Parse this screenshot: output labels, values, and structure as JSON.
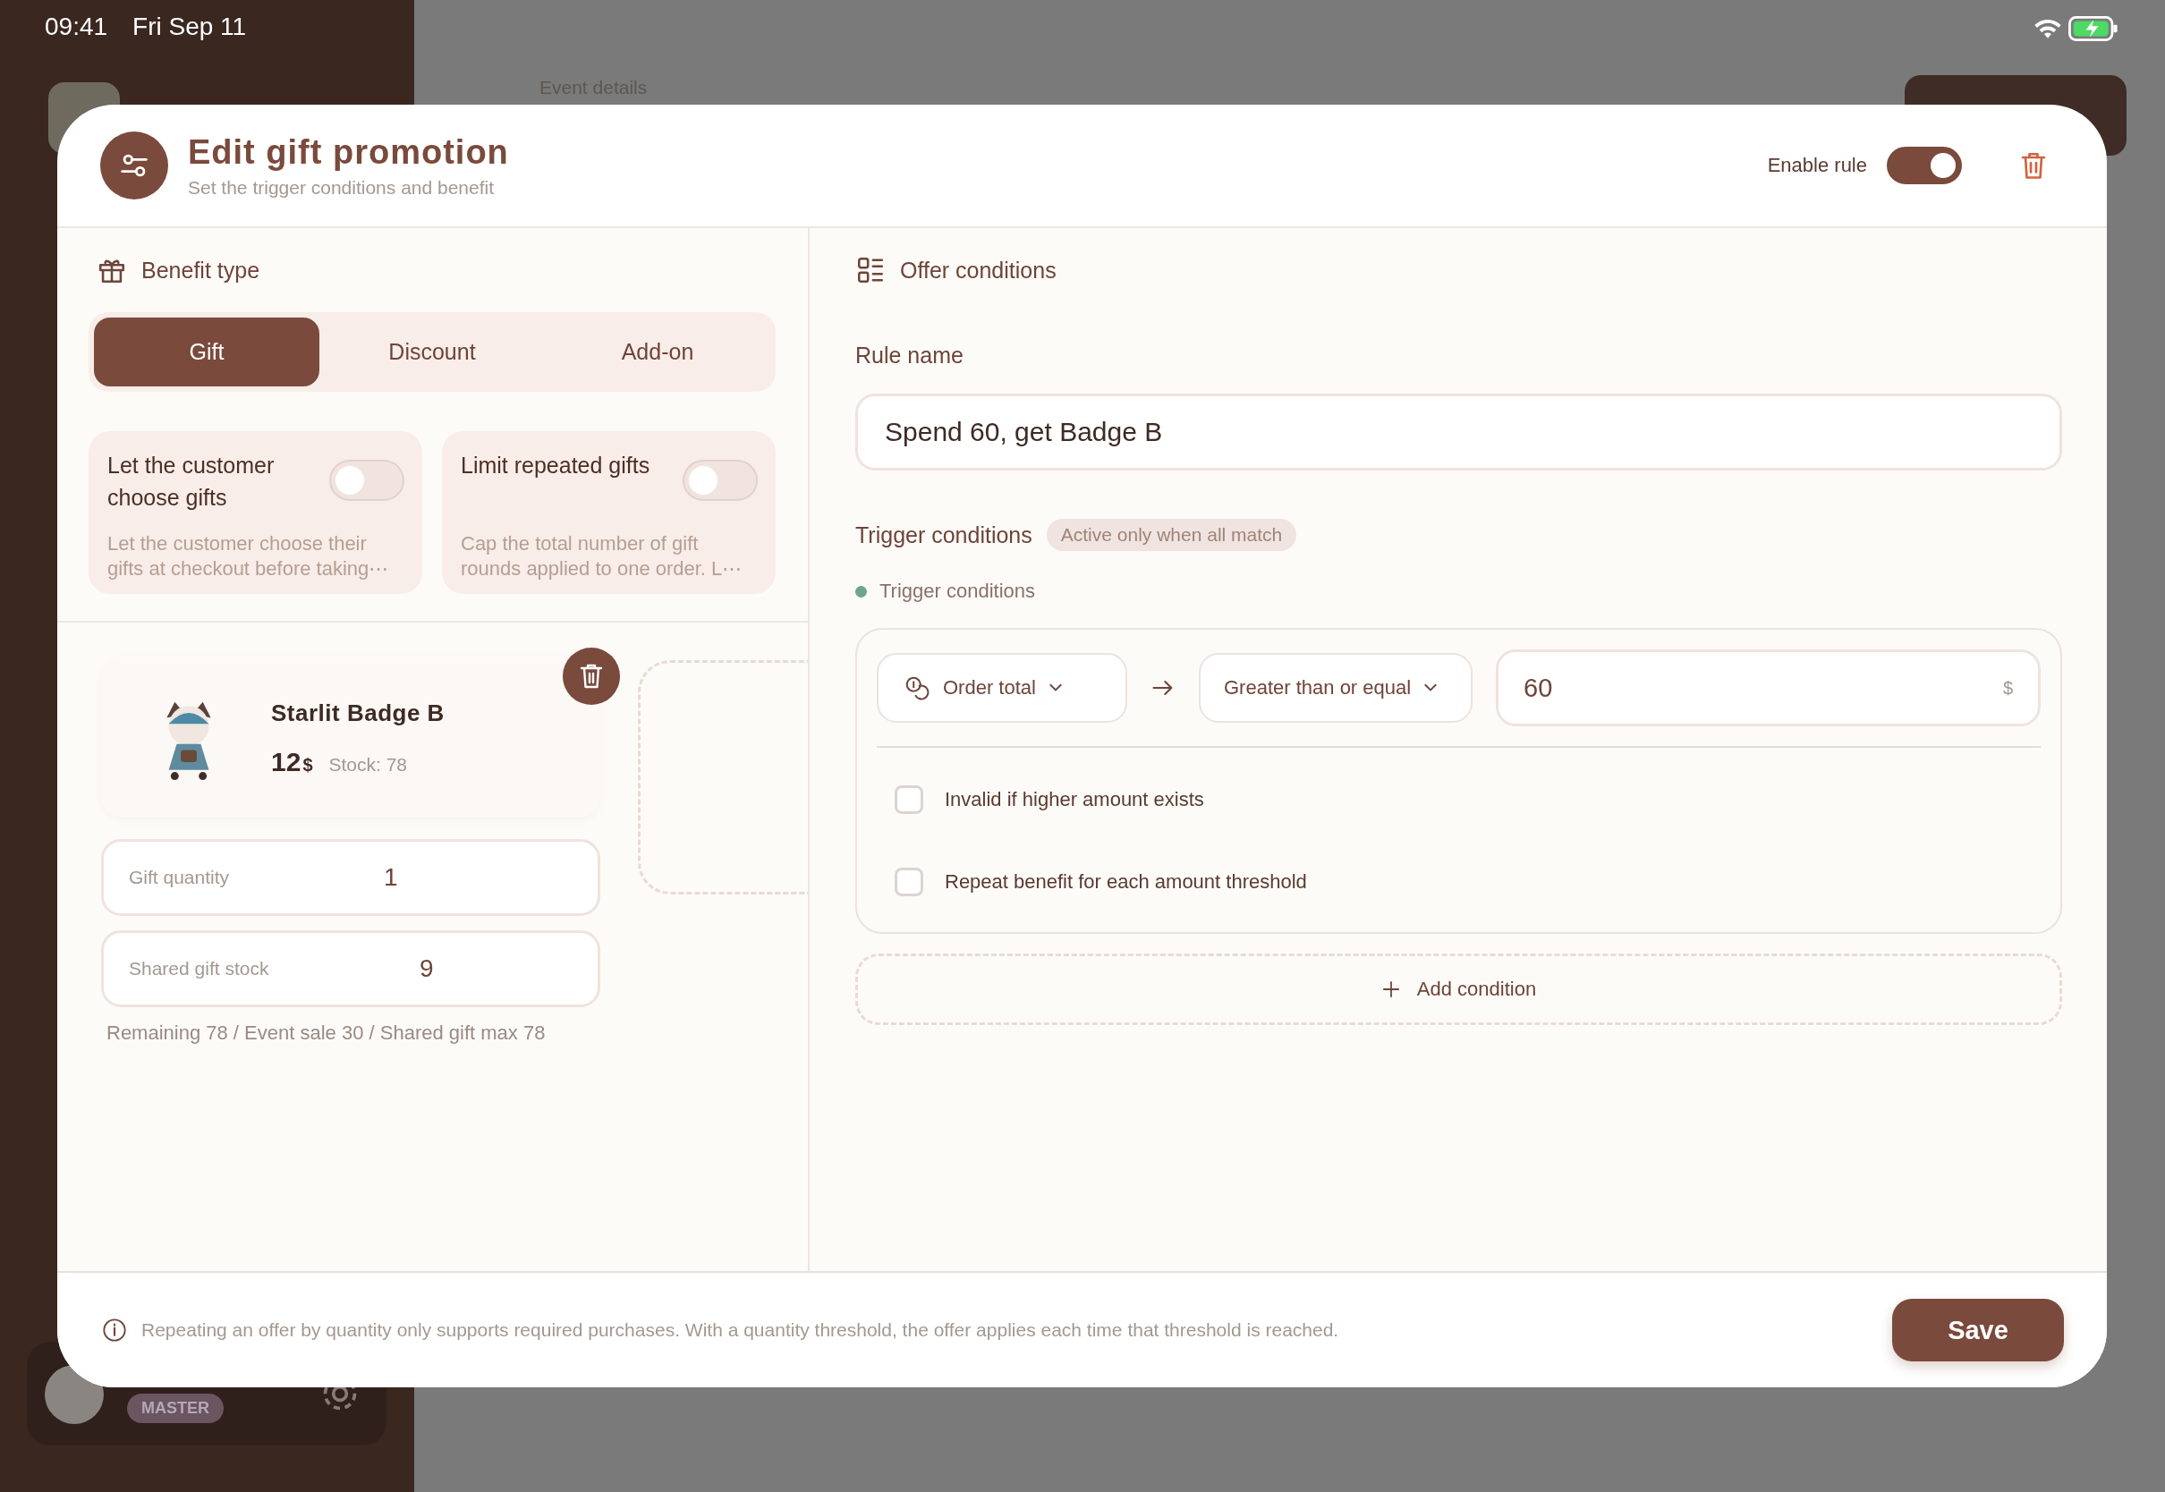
{
  "status_bar": {
    "time": "09:41",
    "date": "Fri Sep 11"
  },
  "background": {
    "page_label": "Event details",
    "badge": "MASTER"
  },
  "dialog": {
    "title": "Edit gift promotion",
    "subtitle": "Set the trigger conditions and benefit",
    "enable_label": "Enable rule",
    "enabled": true
  },
  "benefit": {
    "title": "Benefit type",
    "tabs": [
      {
        "label": "Gift",
        "selected": true
      },
      {
        "label": "Discount",
        "selected": false
      },
      {
        "label": "Add-on",
        "selected": false
      }
    ],
    "options": [
      {
        "title": "Let the customer choose gifts",
        "description": "Let the customer choose their gifts at checkout before taking⋯",
        "on": false
      },
      {
        "title": "Limit repeated gifts",
        "description": "Cap the total number of gift rounds applied to one order. L⋯",
        "on": false
      }
    ]
  },
  "gift": {
    "name": "Starlit Badge B",
    "price": "12",
    "currency": "$",
    "stock": "Stock: 78",
    "fields": [
      {
        "label": "Gift quantity",
        "value": "1"
      },
      {
        "label": "Shared gift stock",
        "value": "9"
      }
    ],
    "note": "Remaining 78 / Event sale 30 / Shared gift max 78"
  },
  "conditions": {
    "title": "Offer conditions",
    "rule_name_label": "Rule name",
    "rule_name": "Spend 60, get Badge B",
    "trigger_title": "Trigger conditions",
    "trigger_badge": "Active only when all match",
    "group_label": "Trigger conditions",
    "metric": "Order total",
    "operator": "Greater than or equal",
    "amount": "60",
    "unit": "$",
    "checks": [
      {
        "label": "Invalid if higher amount exists",
        "checked": false
      },
      {
        "label": "Repeat benefit for each amount threshold",
        "checked": false
      }
    ],
    "add_label": "Add condition"
  },
  "footer": {
    "note": "Repeating an offer by quantity only supports required purchases. With a quantity threshold, the offer applies each time that threshold is reached.",
    "save": "Save"
  }
}
